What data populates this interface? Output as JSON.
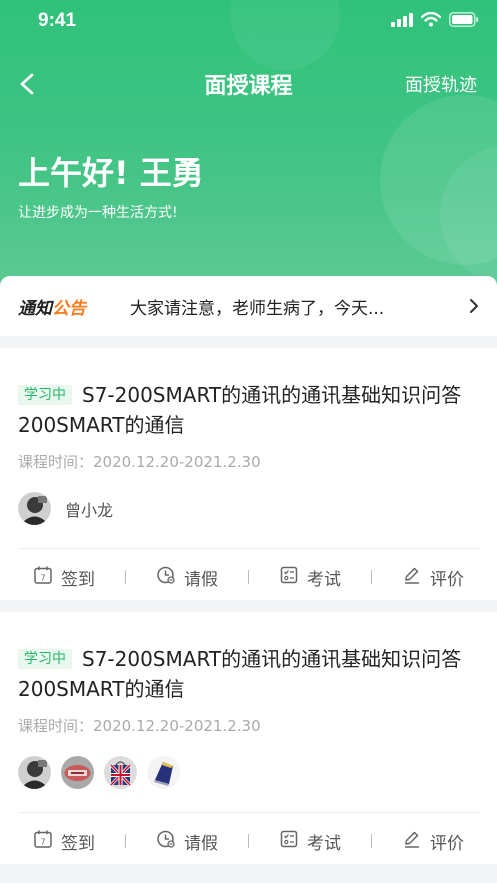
{
  "status_bar": {
    "time": "9:41",
    "icons": [
      "signal-icon",
      "wifi-icon",
      "battery-icon"
    ]
  },
  "nav": {
    "back_icon": "back-chevron-icon",
    "title": "面授课程",
    "right_link": "面授轨迹"
  },
  "hero": {
    "greeting": "上午好! 王勇",
    "slogan": "让进步成为一种生活方式!"
  },
  "notice": {
    "logo_part1": "通知",
    "logo_part2": "公告",
    "text": "大家请注意，老师生病了，今天...",
    "arrow_icon": "chevron-right-icon"
  },
  "courses": [
    {
      "status": "学习中",
      "title": "S7-200SMART的通讯的通讯基础知识问答200SMART的通信",
      "time": "课程时间：2020.12.20-2021.2.30",
      "teacher_name": "曾小龙",
      "avatars": [
        "avatar-1"
      ]
    },
    {
      "status": "学习中",
      "title": "S7-200SMART的通讯的通讯基础知识问答200SMART的通信",
      "time": "课程时间：2020.12.20-2021.2.30",
      "avatars": [
        "avatar-1",
        "avatar-2",
        "avatar-3",
        "avatar-4"
      ]
    }
  ],
  "actions": {
    "checkin": "签到",
    "leave": "请假",
    "exam": "考试",
    "review": "评价"
  },
  "colors": {
    "header_green": "#2fc27a",
    "badge_green": "#28b86a",
    "notice_orange": "#ff7a1a"
  }
}
